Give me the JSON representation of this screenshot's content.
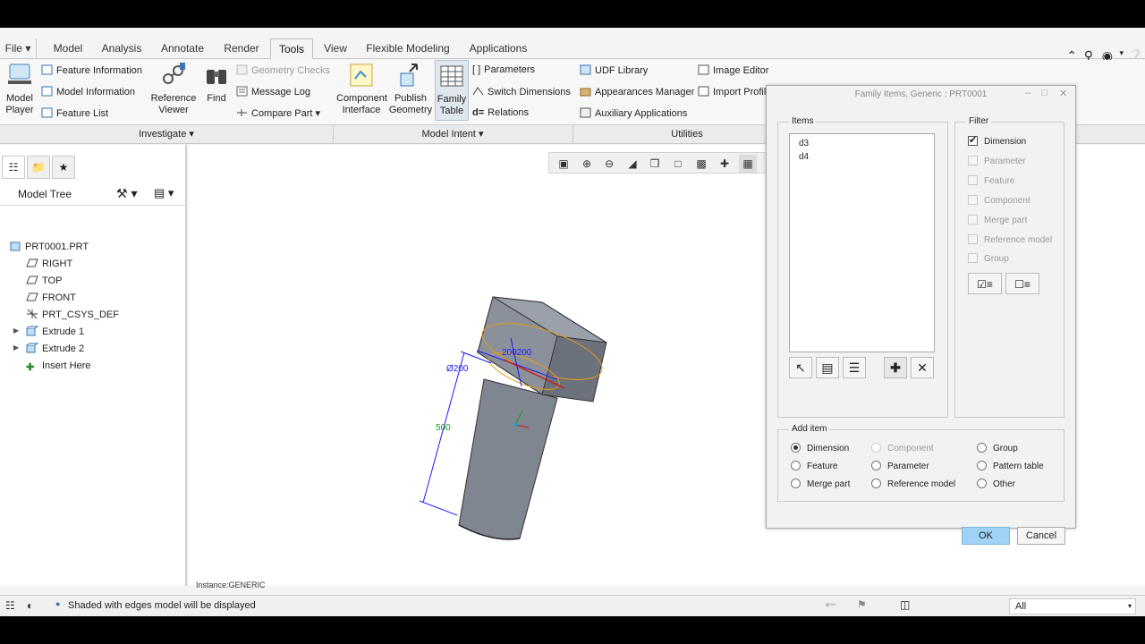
{
  "tabs": [
    "File",
    "Model",
    "Analysis",
    "Annotate",
    "Render",
    "Tools",
    "View",
    "Flexible Modeling",
    "Applications"
  ],
  "active_tab": "Tools",
  "ribbon": {
    "model_player": "Model\nPlayer",
    "feature_information": "Feature Information",
    "model_information": "Model Information",
    "feature_list": "Feature List",
    "reference_viewer": "Reference\nViewer",
    "find": "Find",
    "geometry_checks": "Geometry Checks",
    "message_log": "Message Log",
    "compare_part": "Compare Part",
    "component_interface": "Component\nInterface",
    "publish_geometry": "Publish\nGeometry",
    "family_table": "Family\nTable",
    "parameters": "Parameters",
    "switch_dimensions": "Switch Dimensions",
    "relations": "Relations",
    "udf_library": "UDF Library",
    "appearances_manager": "Appearances Manager",
    "auxiliary_applications": "Auxiliary Applications",
    "image_editor": "Image Editor",
    "import_profile": "Import Profile"
  },
  "groups": {
    "investigate": "Investigate",
    "model_intent": "Model Intent",
    "utilities": "Utilities"
  },
  "model_tree": {
    "title": "Model Tree",
    "items": [
      "PRT0001.PRT",
      "RIGHT",
      "TOP",
      "FRONT",
      "PRT_CSYS_DEF",
      "Extrude 1",
      "Extrude 2",
      "Insert Here"
    ]
  },
  "graphics": {
    "instance_label": "Instance:GENERIC",
    "dim_diameter": "Ø200",
    "dim_height": "500",
    "dim_head": "200200"
  },
  "status": {
    "message": "Shaded with edges model will be displayed",
    "filter_value": "All"
  },
  "dialog": {
    "title": "Family Items,  Generic : PRT0001",
    "items_legend": "Items",
    "items": [
      "d3",
      "d4"
    ],
    "filter_legend": "Filter",
    "filters": [
      {
        "label": "Dimension",
        "checked": true,
        "enabled": true
      },
      {
        "label": "Parameter",
        "checked": false,
        "enabled": false
      },
      {
        "label": "Feature",
        "checked": false,
        "enabled": false
      },
      {
        "label": "Component",
        "checked": false,
        "enabled": false
      },
      {
        "label": "Merge part",
        "checked": false,
        "enabled": false
      },
      {
        "label": "Reference model",
        "checked": false,
        "enabled": false
      },
      {
        "label": "Group",
        "checked": false,
        "enabled": false
      }
    ],
    "add_item_legend": "Add item",
    "add_items": [
      {
        "label": "Dimension",
        "selected": true,
        "enabled": true
      },
      {
        "label": "Component",
        "selected": false,
        "enabled": false
      },
      {
        "label": "Group",
        "selected": false,
        "enabled": true
      },
      {
        "label": "Feature",
        "selected": false,
        "enabled": true
      },
      {
        "label": "Parameter",
        "selected": false,
        "enabled": true
      },
      {
        "label": "Pattern table",
        "selected": false,
        "enabled": true
      },
      {
        "label": "Merge part",
        "selected": false,
        "enabled": true
      },
      {
        "label": "Reference model",
        "selected": false,
        "enabled": true
      },
      {
        "label": "Other",
        "selected": false,
        "enabled": true
      }
    ],
    "ok": "OK",
    "cancel": "Cancel"
  },
  "colors": {
    "ok_button": "#9fd2f5",
    "dimension_blue": "#1a1aff",
    "dimension_green": "#1a9a1a",
    "selection_orange": "#e69a1a"
  }
}
